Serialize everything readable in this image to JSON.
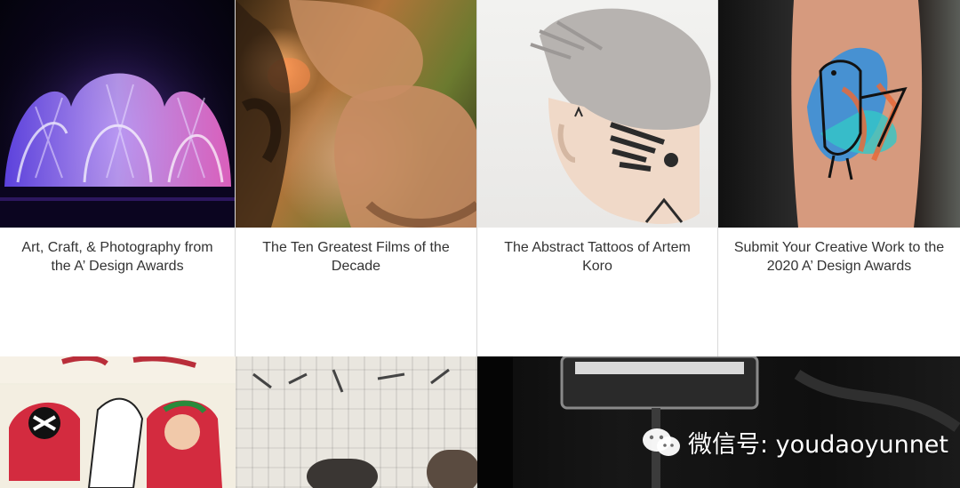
{
  "cards": [
    {
      "title": "Art, Craft, & Photography from the A’ Design Awards"
    },
    {
      "title": "The Ten Greatest Films of the Decade"
    },
    {
      "title": "The Abstract Tattoos of Artem Koro"
    },
    {
      "title": "Submit Your Creative Work to the 2020 A’ Design Awards"
    }
  ],
  "watermark": {
    "text": "微信号: youdaoyunnet",
    "icon": "wechat-icon"
  }
}
